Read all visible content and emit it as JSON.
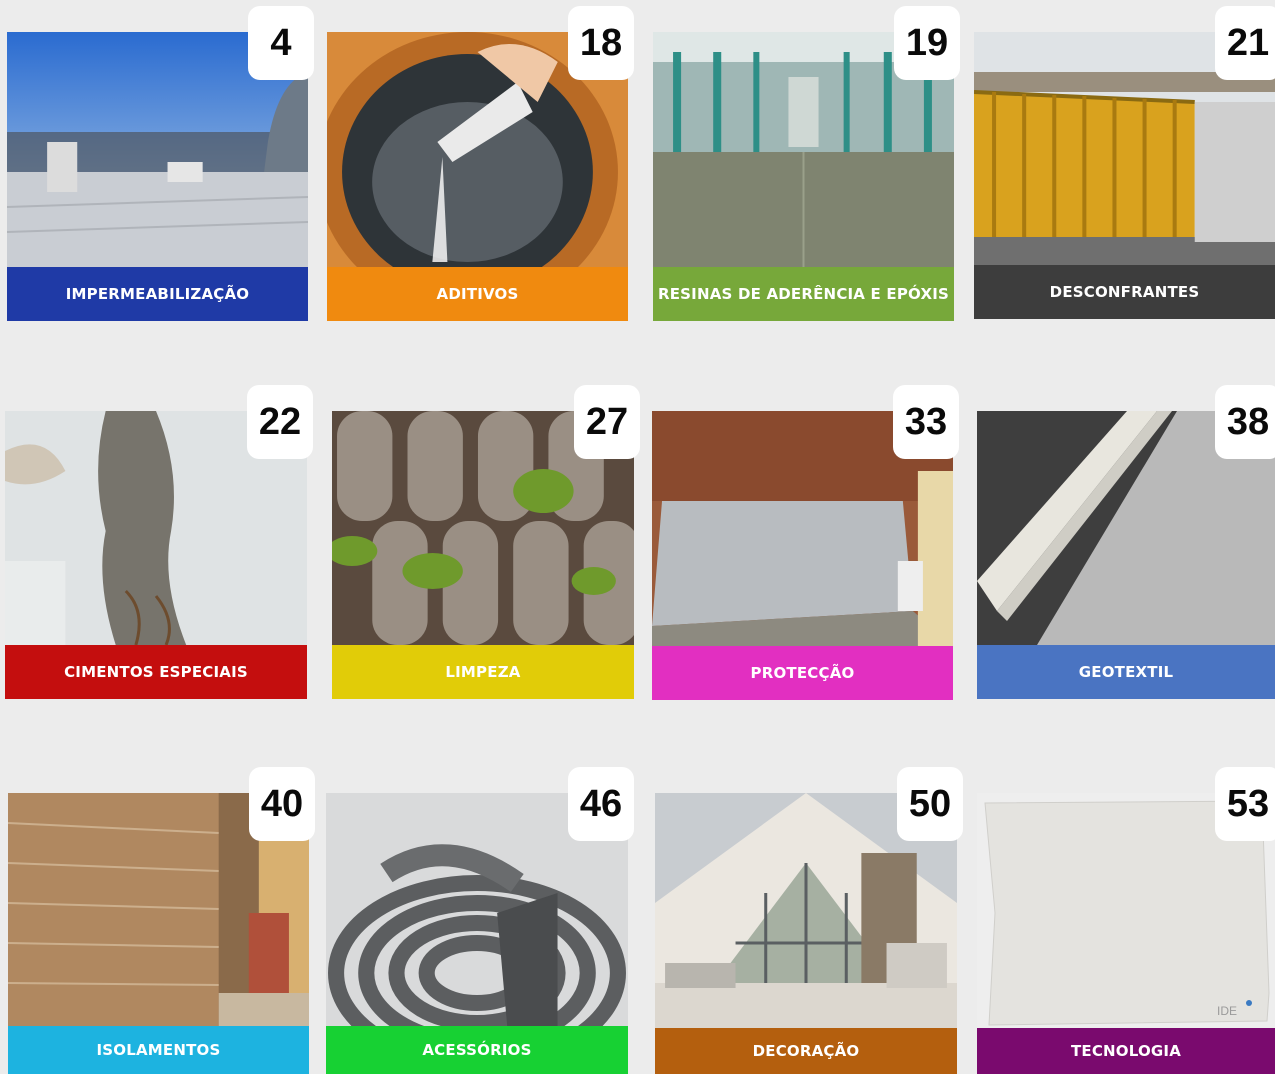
{
  "catalog": {
    "categories": [
      {
        "number": "4",
        "label": "IMPERMEABILIZAÇÃO",
        "color": "#1f3aa6",
        "icon": "flat-roof-photo"
      },
      {
        "number": "18",
        "label": "ADITIVOS",
        "color": "#f08a0f",
        "icon": "pouring-powder-photo"
      },
      {
        "number": "19",
        "label": "RESINAS DE ADERÊNCIA E EPÓXIS",
        "color": "#77a83a",
        "icon": "epoxy-floor-photo"
      },
      {
        "number": "21",
        "label": "DESCONFRANTES",
        "color": "#3d3d3d",
        "icon": "formwork-photo"
      },
      {
        "number": "22",
        "label": "CIMENTOS ESPECIAIS",
        "color": "#c40e0e",
        "icon": "wall-repair-photo"
      },
      {
        "number": "27",
        "label": "LIMPEZA",
        "color": "#e1cc08",
        "icon": "mossy-roof-tiles-photo"
      },
      {
        "number": "33",
        "label": "PROTECÇÃO",
        "color": "#e22fc1",
        "icon": "coated-floor-photo"
      },
      {
        "number": "38",
        "label": "GEOTEXTIL",
        "color": "#4a74c2",
        "icon": "geotextile-roll-photo"
      },
      {
        "number": "40",
        "label": "ISOLAMENTOS",
        "color": "#1db3e0",
        "icon": "insulation-wall-photo"
      },
      {
        "number": "46",
        "label": "ACESSÓRIOS",
        "color": "#17d133",
        "icon": "foam-cord-photo"
      },
      {
        "number": "50",
        "label": "DECORAÇÃO",
        "color": "#b45f0e",
        "icon": "attic-interior-photo"
      },
      {
        "number": "53",
        "label": "TECNOLOGIA",
        "color": "#7a0a6e",
        "icon": "membrane-sheet-photo"
      }
    ]
  }
}
